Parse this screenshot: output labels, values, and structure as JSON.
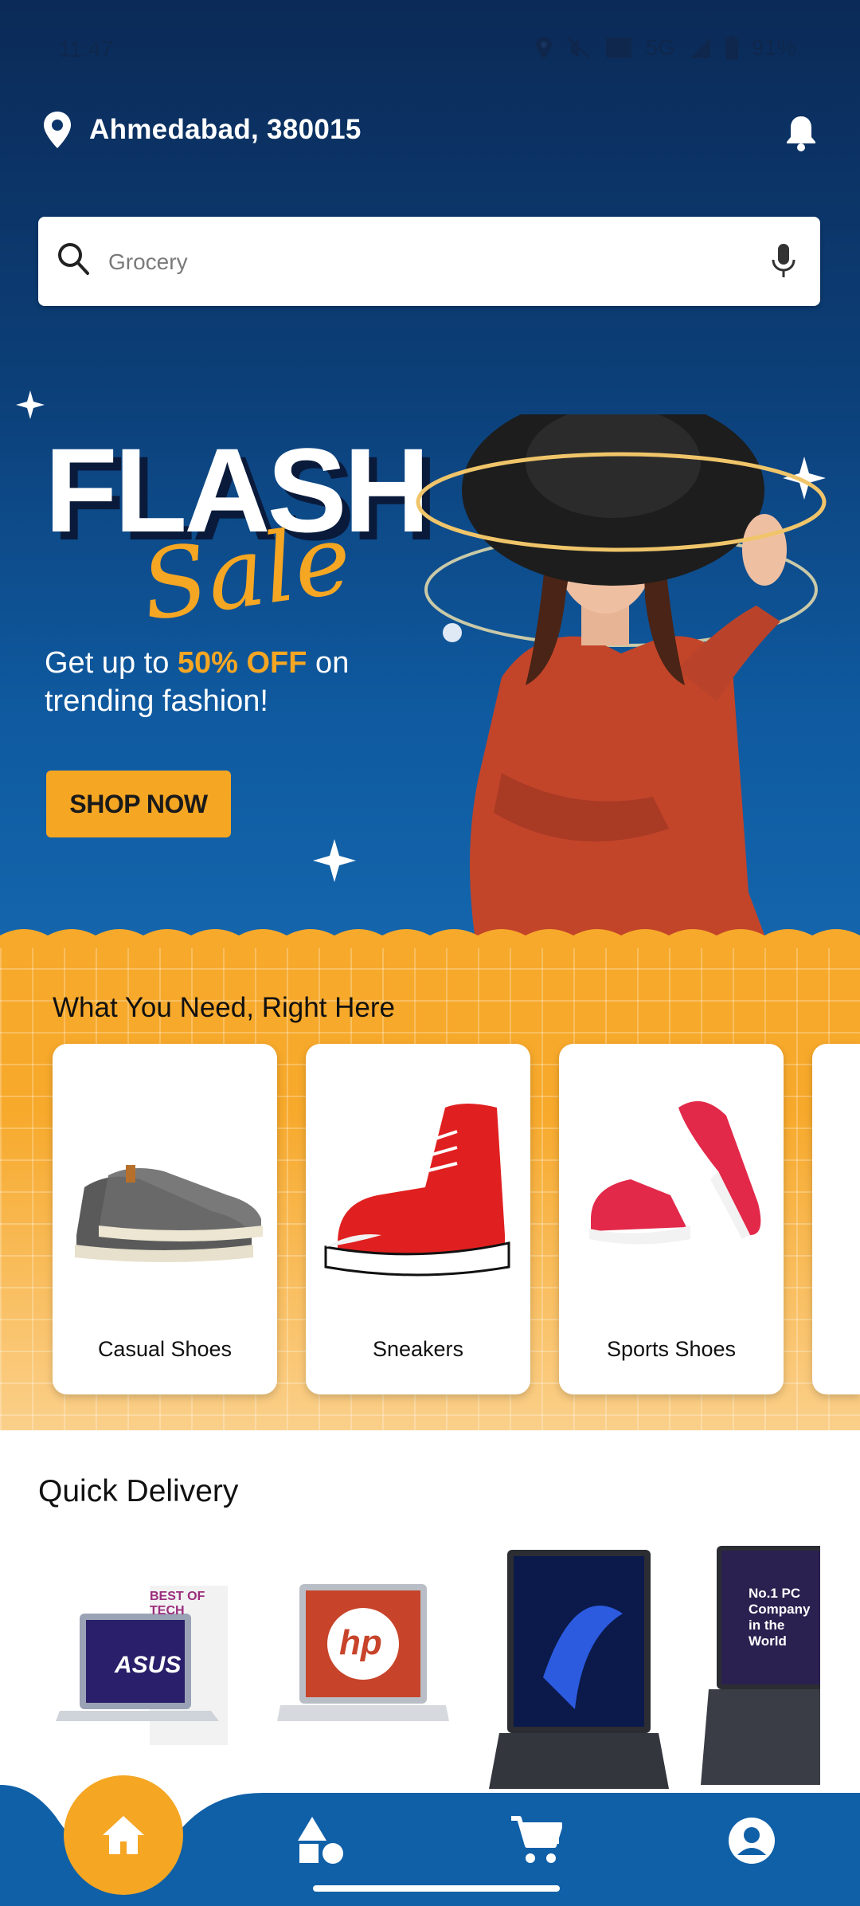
{
  "status_bar": {
    "time": "11:47",
    "network": "5G",
    "battery": "91%"
  },
  "location": {
    "text": "Ahmedabad, 380015"
  },
  "search": {
    "placeholder": "Grocery"
  },
  "banner": {
    "title_line1": "FLASH",
    "title_line2": "Sale",
    "promo_prefix": "Get up to ",
    "promo_highlight": "50% OFF",
    "promo_suffix": " on trending fashion!",
    "cta": "SHOP NOW"
  },
  "categories": {
    "title": "What You Need, Right Here",
    "items": [
      {
        "label": "Casual Shoes"
      },
      {
        "label": "Sneakers"
      },
      {
        "label": "Sports Shoes"
      }
    ]
  },
  "quick_delivery": {
    "title": "Quick Delivery",
    "products": [
      {
        "brand_text": "ASUS",
        "badge": "BEST OF TECH"
      },
      {
        "brand_text": "hp"
      },
      {
        "brand_text": ""
      },
      {
        "brand_text": "No.1 PC Company in the World"
      }
    ]
  },
  "nav": {
    "items": [
      {
        "icon": "home-icon"
      },
      {
        "icon": "categories-icon"
      },
      {
        "icon": "cart-icon"
      },
      {
        "icon": "profile-icon"
      }
    ]
  },
  "colors": {
    "primary": "#0f5aa0",
    "accent": "#f5a623",
    "nav": "#1060a8"
  }
}
